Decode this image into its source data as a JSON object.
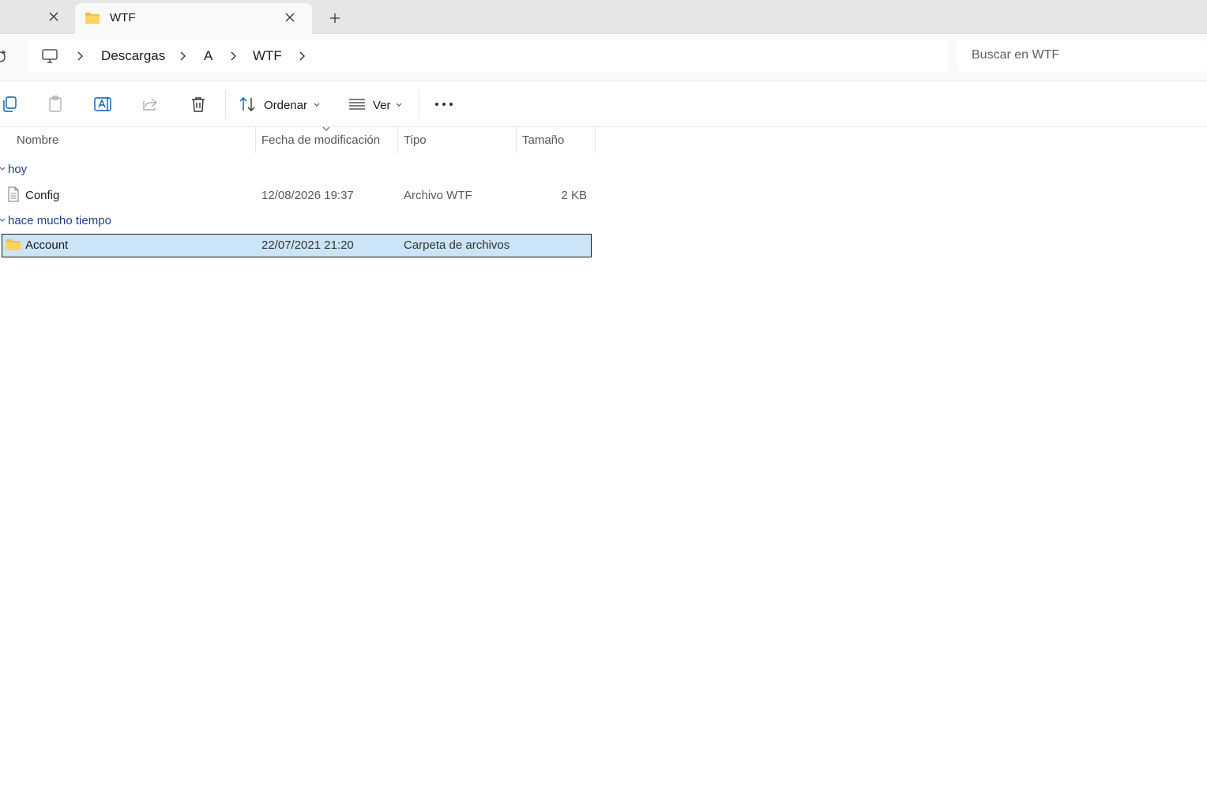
{
  "tabs": {
    "active": {
      "title": "WTF"
    }
  },
  "breadcrumb": [
    "Descargas",
    "A",
    "WTF"
  ],
  "search": {
    "placeholder": "Buscar en WTF"
  },
  "toolbar": {
    "sort_label": "Ordenar",
    "view_label": "Ver"
  },
  "columns": {
    "name": "Nombre",
    "date": "Fecha de modificación",
    "type": "Tipo",
    "size": "Tamaño"
  },
  "groups": [
    {
      "label": "hoy",
      "items": [
        {
          "name": "Config",
          "date": "12/08/2026 19:37",
          "type": "Archivo WTF",
          "size": "2 KB",
          "icon": "file-icon"
        }
      ]
    },
    {
      "label": "hace mucho tiempo",
      "items": [
        {
          "name": "Account",
          "date": "22/07/2021 21:20",
          "type": "Carpeta de archivos",
          "size": "",
          "icon": "folder-icon",
          "selected": true
        }
      ]
    }
  ],
  "colors": {
    "accent": "#005fb8",
    "selection": "#cce4f7",
    "group_text": "#1f3f8f",
    "folder": "#f5c04a"
  }
}
